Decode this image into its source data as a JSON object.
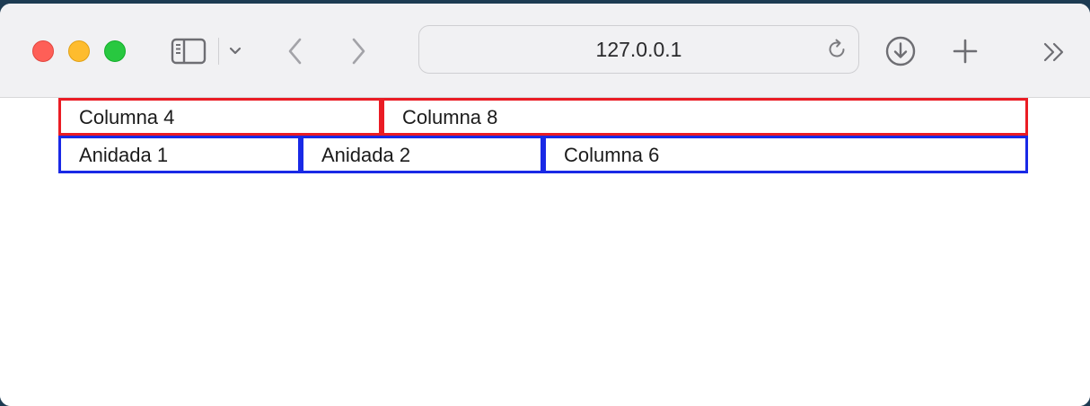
{
  "browser": {
    "url": "127.0.0.1",
    "icons": {
      "close": "close-button",
      "minimize": "minimize-button",
      "maximize": "maximize-button",
      "sidebar": "sidebar-icon",
      "chevron": "chevron-down-icon",
      "back": "chevron-left-icon",
      "forward": "chevron-right-icon",
      "reload": "reload-icon",
      "download": "download-icon",
      "new_tab": "plus-icon",
      "more": "double-chevron-right-icon"
    },
    "colors": {
      "close": "#fe5f57",
      "minimize": "#febc2e",
      "maximize": "#28c840"
    }
  },
  "page": {
    "row1": {
      "col_a": "Columna 4",
      "col_b": "Columna 8",
      "border_color": "#ea1c24"
    },
    "row2": {
      "col_a": "Anidada 1",
      "col_b": "Anidada 2",
      "col_c": "Columna 6",
      "border_color": "#1929e6"
    }
  }
}
